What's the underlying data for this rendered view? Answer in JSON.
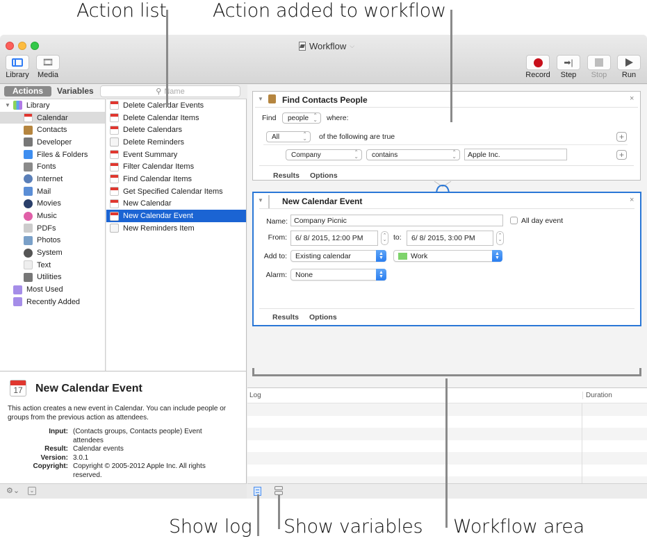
{
  "annotations": {
    "action_list": "Action list",
    "action_added": "Action added to workflow",
    "show_log": "Show log",
    "show_variables": "Show variables",
    "workflow_area": "Workflow area"
  },
  "window": {
    "title": "Workflow",
    "toolbar_left": [
      {
        "label": "Library",
        "icon": "library-icon"
      },
      {
        "label": "Media",
        "icon": "media-icon"
      }
    ],
    "toolbar_right": [
      {
        "label": "Record",
        "icon": "record-icon",
        "enabled": true
      },
      {
        "label": "Step",
        "icon": "step-icon",
        "enabled": true
      },
      {
        "label": "Stop",
        "icon": "stop-icon",
        "enabled": false
      },
      {
        "label": "Run",
        "icon": "run-icon",
        "enabled": true
      }
    ]
  },
  "library_panel": {
    "tabs": [
      "Actions",
      "Variables"
    ],
    "active_tab": "Actions",
    "search_placeholder": "Name",
    "root": "Library",
    "categories": [
      "Calendar",
      "Contacts",
      "Developer",
      "Files & Folders",
      "Fonts",
      "Internet",
      "Mail",
      "Movies",
      "Music",
      "PDFs",
      "Photos",
      "System",
      "Text",
      "Utilities"
    ],
    "selected_category": "Calendar",
    "smart_groups": [
      "Most Used",
      "Recently Added"
    ]
  },
  "actions_list": {
    "items": [
      "Delete Calendar Events",
      "Delete Calendar Items",
      "Delete Calendars",
      "Delete Reminders",
      "Event Summary",
      "Filter Calendar Items",
      "Find Calendar Items",
      "Get Specified Calendar Items",
      "New Calendar",
      "New Calendar Event",
      "New Reminders Item"
    ],
    "selected": "New Calendar Event"
  },
  "description": {
    "title": "New Calendar Event",
    "text": "This action creates a new event in Calendar. You can include people or groups from the previous action as attendees.",
    "fields": [
      {
        "key": "Input:",
        "value": "(Contacts groups, Contacts people) Event attendees"
      },
      {
        "key": "Result:",
        "value": "Calendar events"
      },
      {
        "key": "Version:",
        "value": "3.0.1"
      },
      {
        "key": "Copyright:",
        "value": "Copyright © 2005-2012 Apple Inc.  All rights reserved."
      }
    ]
  },
  "workflow": {
    "find_contacts": {
      "title": "Find Contacts People",
      "find_label": "Find",
      "find_value": "people",
      "where_label": "where:",
      "match_value": "All",
      "match_suffix": "of the following are true",
      "field_value": "Company",
      "operator_value": "contains",
      "text_value": "Apple Inc.",
      "footer": [
        "Results",
        "Options"
      ]
    },
    "new_event": {
      "title": "New Calendar Event",
      "name_label": "Name:",
      "name_value": "Company Picnic",
      "all_day_label": "All day event",
      "all_day_checked": false,
      "from_label": "From:",
      "from_value": "6/  8/ 2015, 12:00 PM",
      "to_label": "to:",
      "to_value": "6/  8/ 2015,   3:00 PM",
      "add_to_label": "Add to:",
      "add_to_value": "Existing calendar",
      "calendar_value": "Work",
      "calendar_color": "#7ed36b",
      "alarm_label": "Alarm:",
      "alarm_value": "None",
      "footer": [
        "Results",
        "Options"
      ]
    }
  },
  "log": {
    "columns": [
      "Log",
      "Duration"
    ]
  }
}
